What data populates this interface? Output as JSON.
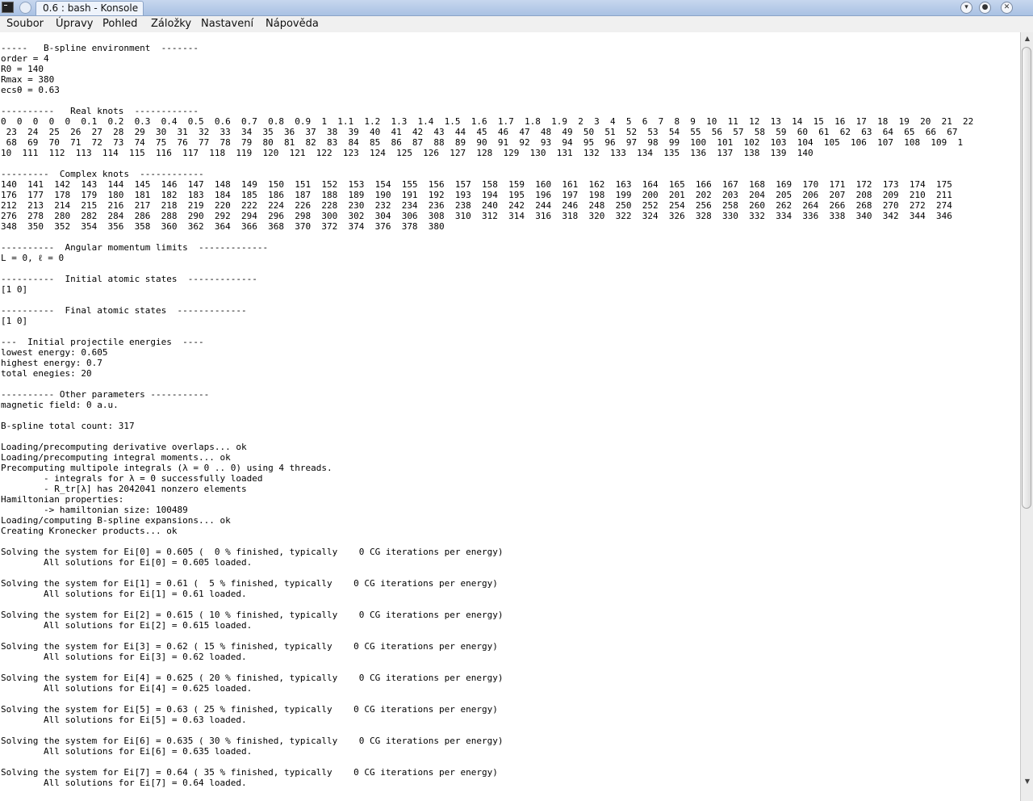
{
  "window": {
    "title": "0.6 : bash - Konsole",
    "app_icon": "terminal-icon",
    "pin_icon": "pin-icon",
    "minimize_icon": "chevron-down-icon",
    "close_icon": "close-icon"
  },
  "menubar": {
    "items": [
      "Soubor",
      "Úpravy",
      "Pohled",
      "Záložky",
      "Nastavení",
      "Nápověda"
    ]
  },
  "scrollbar": {
    "up_icon": "arrow-up-icon",
    "down_icon": "arrow-down-icon",
    "up_glyph": "▲",
    "down_glyph": "▼"
  },
  "terminal": {
    "lines": [
      "-----   B-spline environment  -------",
      "order = 4",
      "R0 = 140",
      "Rmax = 380",
      "ecsθ = 0.63",
      "",
      "----------   Real knots  ------------",
      "0  0  0  0  0  0.1  0.2  0.3  0.4  0.5  0.6  0.7  0.8  0.9  1  1.1  1.2  1.3  1.4  1.5  1.6  1.7  1.8  1.9  2  3  4  5  6  7  8  9  10  11  12  13  14  15  16  17  18  19  20  21  22",
      " 23  24  25  26  27  28  29  30  31  32  33  34  35  36  37  38  39  40  41  42  43  44  45  46  47  48  49  50  51  52  53  54  55  56  57  58  59  60  61  62  63  64  65  66  67",
      " 68  69  70  71  72  73  74  75  76  77  78  79  80  81  82  83  84  85  86  87  88  89  90  91  92  93  94  95  96  97  98  99  100  101  102  103  104  105  106  107  108  109  1",
      "10  111  112  113  114  115  116  117  118  119  120  121  122  123  124  125  126  127  128  129  130  131  132  133  134  135  136  137  138  139  140",
      "",
      "---------  Complex knots  ------------",
      "140  141  142  143  144  145  146  147  148  149  150  151  152  153  154  155  156  157  158  159  160  161  162  163  164  165  166  167  168  169  170  171  172  173  174  175",
      "176  177  178  179  180  181  182  183  184  185  186  187  188  189  190  191  192  193  194  195  196  197  198  199  200  201  202  203  204  205  206  207  208  209  210  211",
      "212  213  214  215  216  217  218  219  220  222  224  226  228  230  232  234  236  238  240  242  244  246  248  250  252  254  256  258  260  262  264  266  268  270  272  274",
      "276  278  280  282  284  286  288  290  292  294  296  298  300  302  304  306  308  310  312  314  316  318  320  322  324  326  328  330  332  334  336  338  340  342  344  346",
      "348  350  352  354  356  358  360  362  364  366  368  370  372  374  376  378  380",
      "",
      "----------  Angular momentum limits  -------------",
      "L = 0, ℓ = 0",
      "",
      "----------  Initial atomic states  -------------",
      "[1 0]",
      "",
      "----------  Final atomic states  -------------",
      "[1 0]",
      "",
      "---  Initial projectile energies  ----",
      "lowest energy: 0.605",
      "highest energy: 0.7",
      "total enegies: 20",
      "",
      "---------- Other parameters -----------",
      "magnetic field: 0 a.u.",
      "",
      "B-spline total count: 317",
      "",
      "Loading/precomputing derivative overlaps... ok",
      "Loading/precomputing integral moments... ok",
      "Precomputing multipole integrals (λ = 0 .. 0) using 4 threads.",
      "        - integrals for λ = 0 successfully loaded",
      "        - R_tr[λ] has 2042041 nonzero elements",
      "Hamiltonian properties:",
      "        -> hamiltonian size: 100489",
      "Loading/computing B-spline expansions... ok",
      "Creating Kronecker products... ok",
      "",
      "Solving the system for Ei[0] = 0.605 (  0 % finished, typically    0 CG iterations per energy)",
      "        All solutions for Ei[0] = 0.605 loaded.",
      "",
      "Solving the system for Ei[1] = 0.61 (  5 % finished, typically    0 CG iterations per energy)",
      "        All solutions for Ei[1] = 0.61 loaded.",
      "",
      "Solving the system for Ei[2] = 0.615 ( 10 % finished, typically    0 CG iterations per energy)",
      "        All solutions for Ei[2] = 0.615 loaded.",
      "",
      "Solving the system for Ei[3] = 0.62 ( 15 % finished, typically    0 CG iterations per energy)",
      "        All solutions for Ei[3] = 0.62 loaded.",
      "",
      "Solving the system for Ei[4] = 0.625 ( 20 % finished, typically    0 CG iterations per energy)",
      "        All solutions for Ei[4] = 0.625 loaded.",
      "",
      "Solving the system for Ei[5] = 0.63 ( 25 % finished, typically    0 CG iterations per energy)",
      "        All solutions for Ei[5] = 0.63 loaded.",
      "",
      "Solving the system for Ei[6] = 0.635 ( 30 % finished, typically    0 CG iterations per energy)",
      "        All solutions for Ei[6] = 0.635 loaded.",
      "",
      "Solving the system for Ei[7] = 0.64 ( 35 % finished, typically    0 CG iterations per energy)",
      "        All solutions for Ei[7] = 0.64 loaded."
    ]
  }
}
